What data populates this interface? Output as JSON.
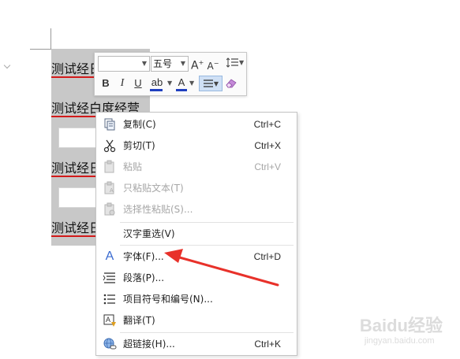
{
  "document": {
    "lines": [
      "测试经日",
      "测试经白度经营",
      "测试经日",
      "测试经日"
    ]
  },
  "mini_toolbar": {
    "font_name": "",
    "font_size": "五号",
    "grow_label": "A",
    "shrink_label": "A",
    "bold_label": "B",
    "italic_label": "I",
    "underline_label": "U",
    "highlight_label": "ab",
    "font_color_label": "A",
    "font_color": "#1f3fbf",
    "highlight_color": "#1f3fbf"
  },
  "context_menu": {
    "items": [
      {
        "label": "复制(C)",
        "shortcut": "Ctrl+C",
        "icon": "copy-icon",
        "enabled": true
      },
      {
        "label": "剪切(T)",
        "shortcut": "Ctrl+X",
        "icon": "scissors-icon",
        "enabled": true
      },
      {
        "label": "粘贴",
        "shortcut": "Ctrl+V",
        "icon": "paste-icon",
        "enabled": false
      },
      {
        "label": "只粘贴文本(T)",
        "shortcut": "",
        "icon": "paste-text-icon",
        "enabled": false
      },
      {
        "label": "选择性粘贴(S)...",
        "shortcut": "",
        "icon": "paste-special-icon",
        "enabled": false
      },
      {
        "label": "汉字重选(V)",
        "shortcut": "",
        "icon": "",
        "enabled": true
      },
      {
        "label": "字体(F)...",
        "shortcut": "Ctrl+D",
        "icon": "font-icon",
        "enabled": true
      },
      {
        "label": "段落(P)...",
        "shortcut": "",
        "icon": "paragraph-icon",
        "enabled": true
      },
      {
        "label": "项目符号和编号(N)...",
        "shortcut": "",
        "icon": "bullet-list-icon",
        "enabled": true
      },
      {
        "label": "翻译(T)",
        "shortcut": "",
        "icon": "translate-icon",
        "enabled": true
      },
      {
        "label": "超链接(H)...",
        "shortcut": "Ctrl+K",
        "icon": "hyperlink-icon",
        "enabled": true
      }
    ]
  },
  "annotation": {
    "arrow_color": "#e8312a"
  },
  "watermark": {
    "brand": "Baidu经验",
    "url": "jingyan.baidu.com"
  }
}
